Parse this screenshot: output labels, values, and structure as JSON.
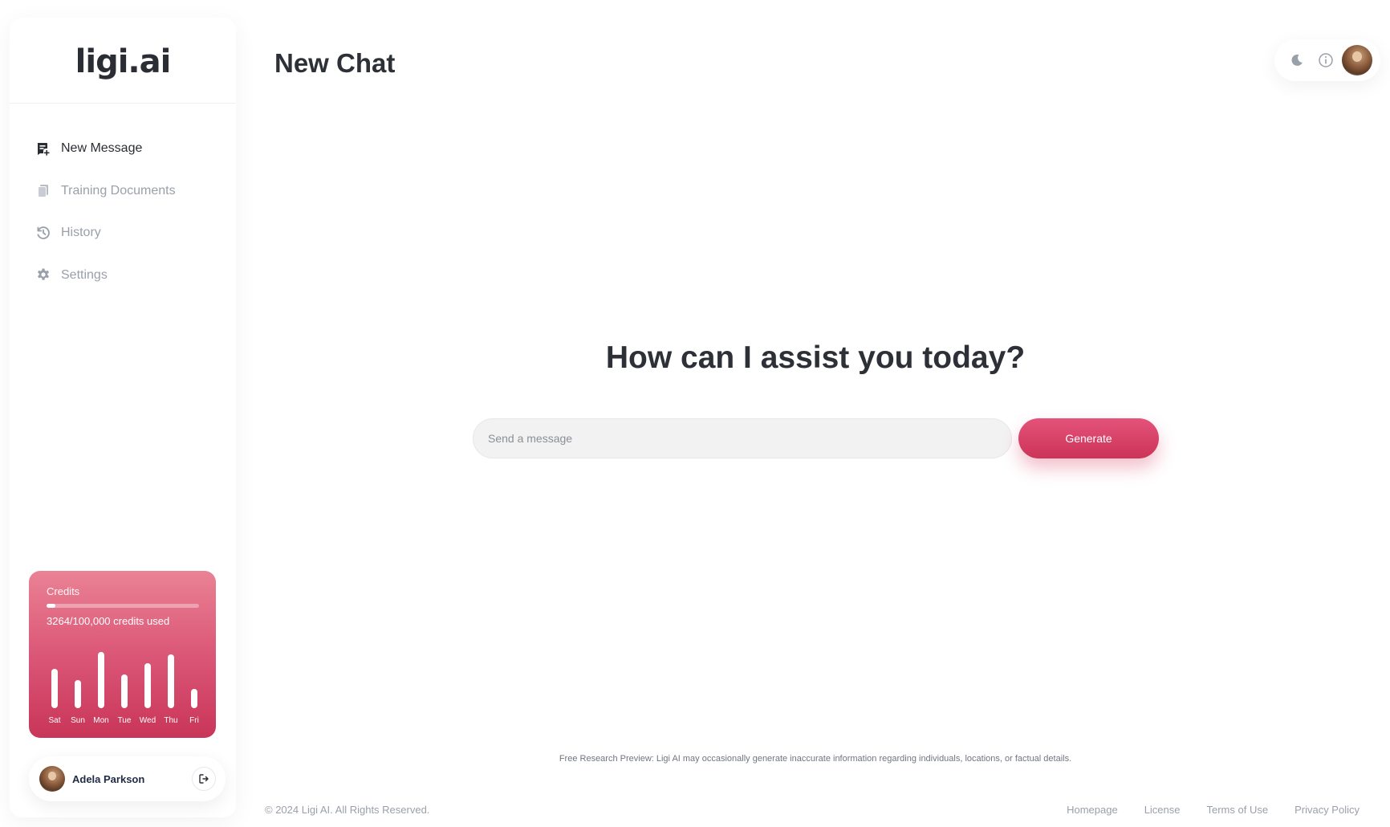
{
  "app": {
    "logo_text": "ligi.ai"
  },
  "sidebar": {
    "items": [
      {
        "label": "New Message",
        "icon": "new-message-icon"
      },
      {
        "label": "Training Documents",
        "icon": "documents-icon"
      },
      {
        "label": "History",
        "icon": "history-icon"
      },
      {
        "label": "Settings",
        "icon": "gear-icon"
      }
    ],
    "active_index": 0
  },
  "credits": {
    "title": "Credits",
    "used_text": "3264/100,000 credits used",
    "used_fraction": 0.0326,
    "chart_days": [
      "Sat",
      "Sun",
      "Mon",
      "Tue",
      "Wed",
      "Thu",
      "Fri"
    ],
    "chart_levels": [
      0.68,
      0.48,
      0.97,
      0.58,
      0.78,
      0.93,
      0.33
    ]
  },
  "user": {
    "name": "Adela Parkson"
  },
  "header": {
    "title": "New Chat"
  },
  "topbar": {
    "icons": [
      "moon-icon",
      "info-icon",
      "avatar"
    ]
  },
  "main": {
    "headline": "How can I assist you today?",
    "input_placeholder": "Send a message",
    "generate_label": "Generate"
  },
  "footer": {
    "disclaimer": "Free Research Preview: Ligi AI may occasionally generate inaccurate information regarding individuals, locations, or factual details.",
    "copyright": "© 2024  Ligi AI. All Rights Reserved.",
    "links": [
      "Homepage",
      "License",
      "Terms of Use",
      "Privacy Policy"
    ]
  },
  "colors": {
    "accent": "#d63c60",
    "accent_light": "#ea8294",
    "text_dark": "#2d3036",
    "text_muted": "#9aa0aa"
  }
}
